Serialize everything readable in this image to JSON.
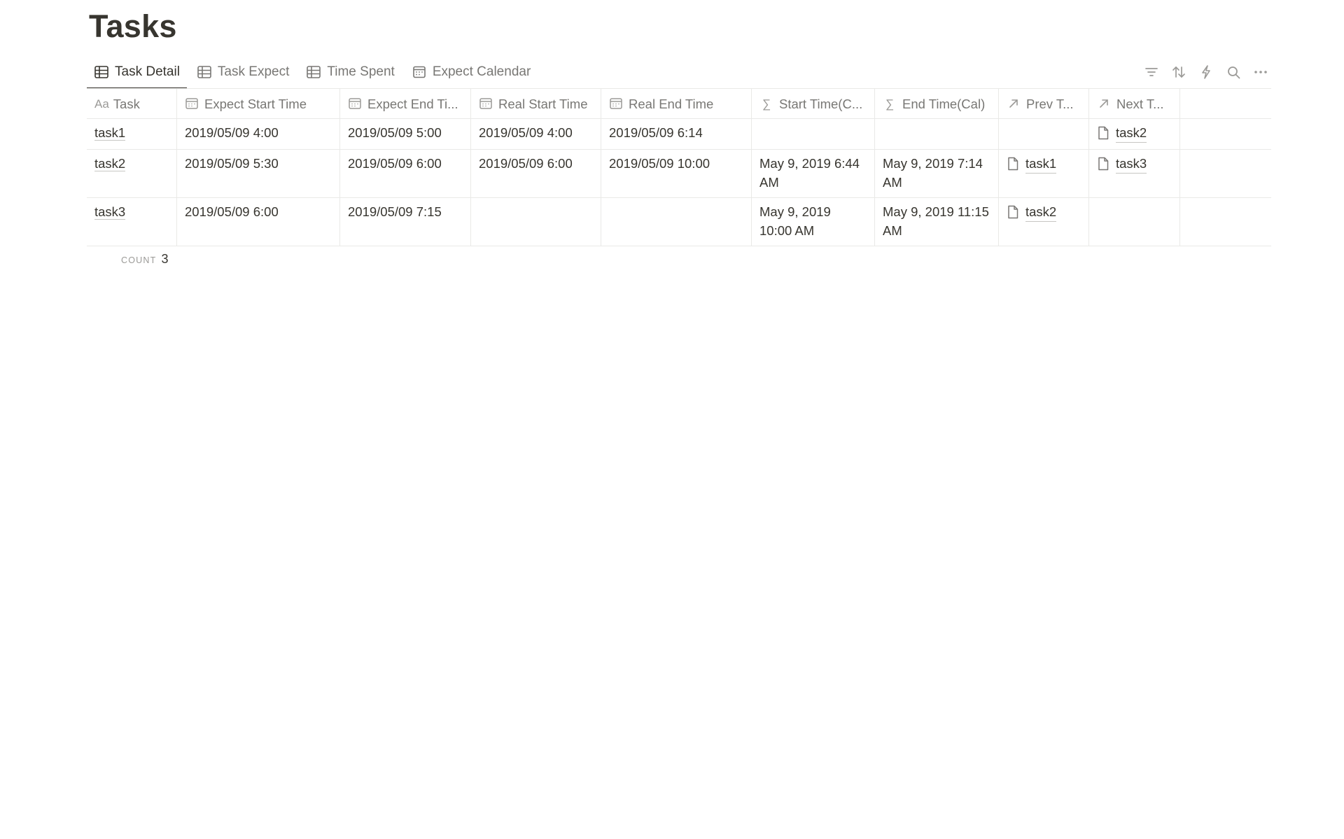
{
  "page": {
    "title": "Tasks"
  },
  "views": [
    {
      "label": "Task Detail",
      "icon": "table-icon",
      "active": true
    },
    {
      "label": "Task Expect",
      "icon": "table-icon",
      "active": false
    },
    {
      "label": "Time Spent",
      "icon": "table-icon",
      "active": false
    },
    {
      "label": "Expect Calendar",
      "icon": "calendar-icon",
      "active": false
    }
  ],
  "toolbar": {
    "icons": [
      "filter-icon",
      "sort-icon",
      "automation-lightning-icon",
      "search-icon",
      "more-options-icon"
    ]
  },
  "table": {
    "columns": [
      {
        "label": "Task",
        "icon": "text-property-icon",
        "icon_text": "Aa"
      },
      {
        "label": "Expect Start Time",
        "icon": "date-property-icon"
      },
      {
        "label": "Expect End Ti...",
        "icon": "date-property-icon"
      },
      {
        "label": "Real Start Time",
        "icon": "date-property-icon"
      },
      {
        "label": "Real End Time",
        "icon": "date-property-icon"
      },
      {
        "label": "Start Time(C...",
        "icon": "formula-property-icon",
        "icon_text": "∑"
      },
      {
        "label": "End Time(Cal)",
        "icon": "formula-property-icon",
        "icon_text": "∑"
      },
      {
        "label": "Prev T...",
        "icon": "relation-property-icon"
      },
      {
        "label": "Next T...",
        "icon": "relation-property-icon"
      }
    ],
    "rows": [
      {
        "task": "task1",
        "expect_start": "2019/05/09 4:00",
        "expect_end": "2019/05/09 5:00",
        "real_start": "2019/05/09 4:00",
        "real_end": "2019/05/09 6:14",
        "start_calc": "",
        "end_calc": "",
        "prev": "",
        "next": "task2"
      },
      {
        "task": "task2",
        "expect_start": "2019/05/09 5:30",
        "expect_end": "2019/05/09 6:00",
        "real_start": "2019/05/09 6:00",
        "real_end": "2019/05/09 10:00",
        "start_calc": "May 9, 2019 6:44 AM",
        "end_calc": "May 9, 2019 7:14 AM",
        "prev": "task1",
        "next": "task3"
      },
      {
        "task": "task3",
        "expect_start": "2019/05/09 6:00",
        "expect_end": "2019/05/09 7:15",
        "real_start": "",
        "real_end": "",
        "start_calc": "May 9, 2019 10:00 AM",
        "end_calc": "May 9, 2019 11:15 AM",
        "prev": "task2",
        "next": ""
      }
    ]
  },
  "footer": {
    "count_label": "COUNT",
    "count_value": "3"
  }
}
